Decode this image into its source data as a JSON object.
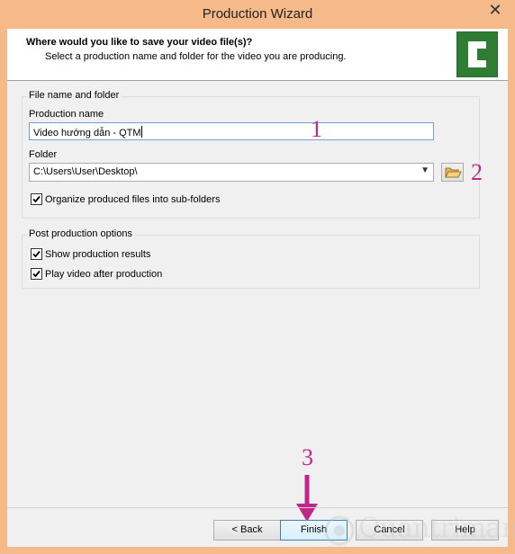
{
  "window": {
    "title": "Production Wizard",
    "close_glyph": "✕"
  },
  "header": {
    "title": "Where would you like to save your video file(s)?",
    "subtitle": "Select a production name and folder for the video you are producing.",
    "logo_icon": "camtasia-logo-icon"
  },
  "file_group": {
    "legend": "File name and folder",
    "production_name_label": "Production name",
    "production_name_value": "Video hướng dẫn - QTM",
    "folder_label": "Folder",
    "folder_value": "C:\\Users\\User\\Desktop\\",
    "organize_label": "Organize produced files into sub-folders",
    "organize_checked": true
  },
  "post_group": {
    "legend": "Post production options",
    "show_results_label": "Show production results",
    "show_results_checked": true,
    "play_video_label": "Play video after production",
    "play_video_checked": true
  },
  "annotations": {
    "one": "1",
    "two": "2",
    "three": "3",
    "color": "#c0278b"
  },
  "buttons": {
    "back": "< Back",
    "finish": "Finish",
    "cancel": "Cancel",
    "help": "Help"
  },
  "watermark": {
    "text": "Quantrimang"
  },
  "colors": {
    "titlebar": "#f5b98a",
    "logo_green": "#2f7d32",
    "accent": "#c0278b"
  }
}
